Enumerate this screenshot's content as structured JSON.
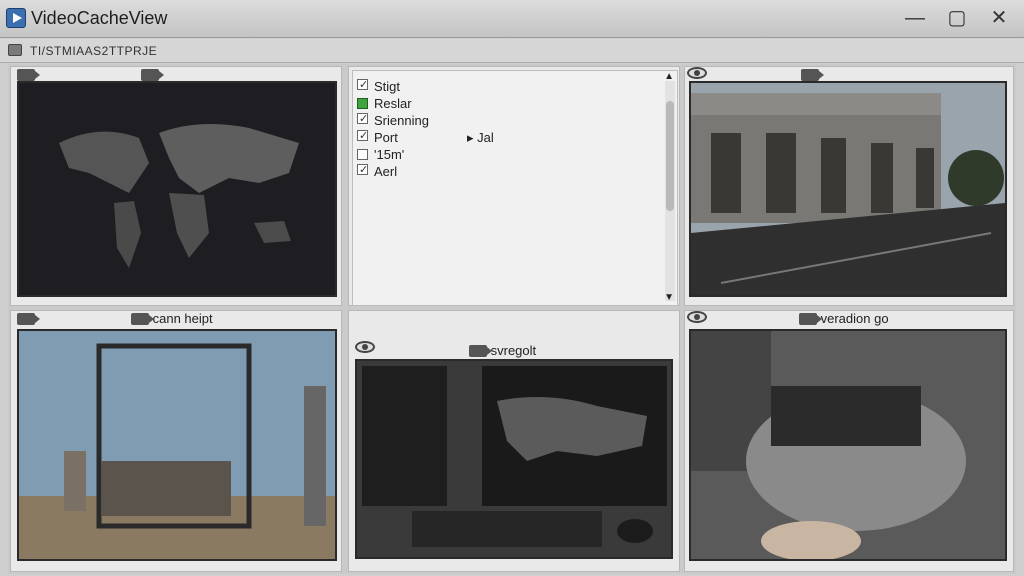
{
  "window": {
    "title": "VideoCacheView",
    "minimize": "—",
    "maximize": "▢",
    "close": "✕"
  },
  "toolbar": {
    "text": "TI/STMIAAS2TTPRJE"
  },
  "list": {
    "items": [
      {
        "label": "Stigt",
        "box": "check"
      },
      {
        "label": "Reslar",
        "box": "green"
      },
      {
        "label": "Srienning",
        "box": "check"
      },
      {
        "label": "Port",
        "box": "check",
        "extra": "Jal"
      },
      {
        "label": "'15m'",
        "box": "plain"
      },
      {
        "label": "Aerl",
        "box": "check"
      }
    ],
    "scroll_up": "▲",
    "scroll_down": "▼"
  },
  "captions": {
    "mid_left": "cann heipt",
    "mid_center": "svregolt",
    "mid_right": "veradion go"
  },
  "icons": [
    "app-icon",
    "camera-icon",
    "eye-icon",
    "checkbox",
    "scroll-arrow"
  ]
}
